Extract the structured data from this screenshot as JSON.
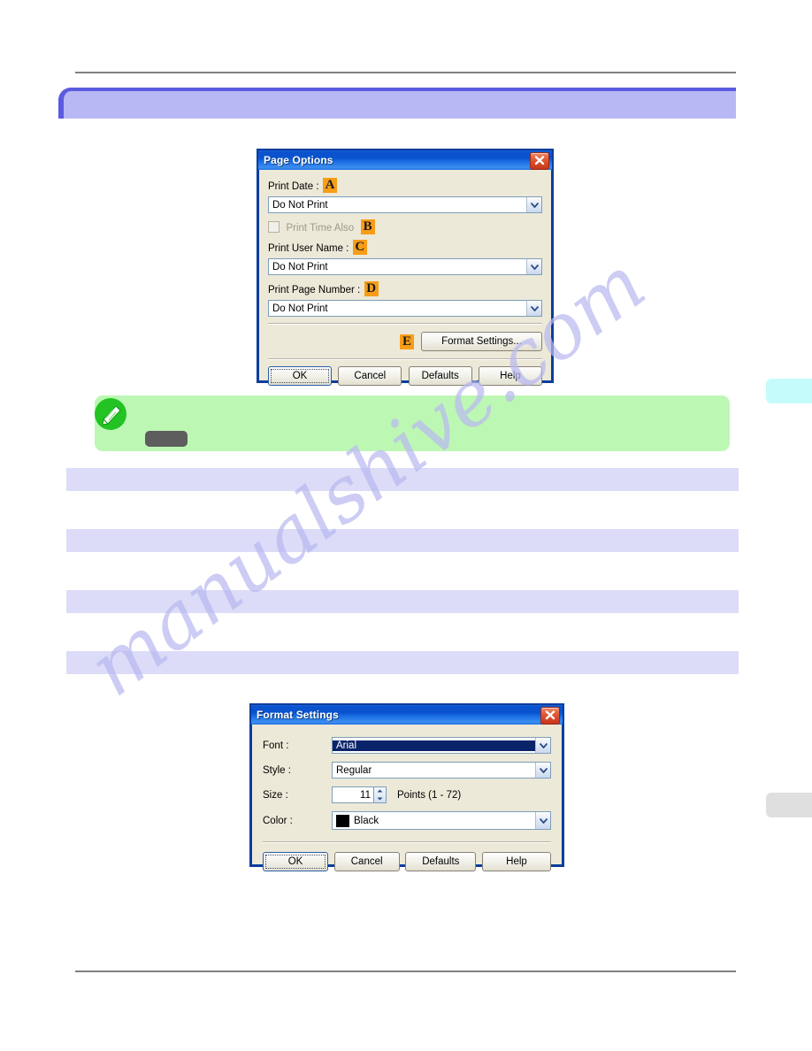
{
  "page": {
    "watermark_text": "manualshive.com"
  },
  "page_options_dialog": {
    "title": "Page Options",
    "close_icon": "close-icon",
    "print_date": {
      "label": "Print Date :",
      "callout": "A",
      "value": "Do Not Print"
    },
    "print_time_also": {
      "label": "Print Time Also",
      "callout": "B",
      "checked": false,
      "disabled": true
    },
    "print_user_name": {
      "label": "Print User Name :",
      "callout": "C",
      "value": "Do Not Print"
    },
    "print_page_number": {
      "label": "Print Page Number :",
      "callout": "D",
      "value": "Do Not Print"
    },
    "format_settings_button": {
      "label": "Format Settings...",
      "callout": "E"
    },
    "buttons": {
      "ok": "OK",
      "cancel": "Cancel",
      "defaults": "Defaults",
      "help": "Help"
    }
  },
  "format_settings_dialog": {
    "title": "Format Settings",
    "close_icon": "close-icon",
    "font": {
      "label": "Font :",
      "value": "Arial"
    },
    "style": {
      "label": "Style :",
      "value": "Regular"
    },
    "size": {
      "label": "Size :",
      "value": "11",
      "units": "Points (1 - 72)"
    },
    "color": {
      "label": "Color :",
      "value": "Black",
      "swatch_hex": "#000000"
    },
    "buttons": {
      "ok": "OK",
      "cancel": "Cancel",
      "defaults": "Defaults",
      "help": "Help"
    }
  },
  "note_box": {
    "icon": "pencil-note-icon"
  },
  "side_tabs": {
    "cyan": "",
    "gray": ""
  },
  "colors": {
    "band": "#dcdcf8",
    "header_band": "#b8b8f5",
    "header_border": "#5b5be0",
    "note_bg": "#bdf7b4",
    "note_icon": "#22c322",
    "callout": "#f79d18",
    "titlebar": "#0a52ce",
    "close": "#c6341a",
    "side_tab_cyan": "#c6fbfb",
    "side_tab_gray": "#dfdfdf",
    "watermark": "#b9b9f0"
  }
}
